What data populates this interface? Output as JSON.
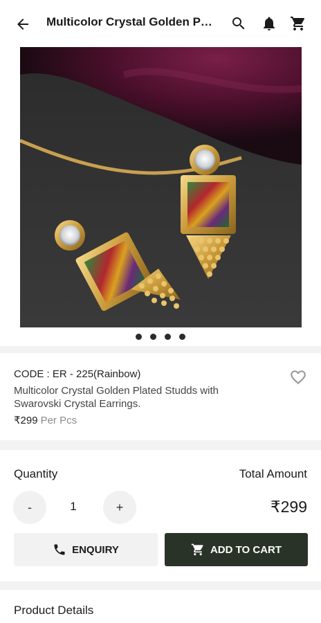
{
  "header": {
    "title": "Multicolor Crystal Golden Plated Studds with Swarovski Crystal Earrings",
    "back_icon": "arrow-back-icon",
    "search_icon": "search-icon",
    "notification_icon": "bell-icon",
    "cart_icon": "cart-icon"
  },
  "gallery": {
    "image_description": "product-photo-earrings",
    "dot_count": 4
  },
  "product": {
    "code": "CODE : ER - 225(Rainbow)",
    "description": "Multicolor Crystal Golden Plated Studds with Swarovski Crystal Earrings.",
    "price": "₹299",
    "unit": "Per Pcs",
    "wishlist_icon": "heart-outline-icon"
  },
  "purchase": {
    "quantity_label": "Quantity",
    "total_label": "Total Amount",
    "decrement_label": "-",
    "quantity_value": "1",
    "increment_label": "+",
    "total_value": "₹299",
    "enquiry_label": "ENQUIRY",
    "add_to_cart_label": "ADD TO CART"
  },
  "details": {
    "title": "Product Details"
  },
  "colors": {
    "cart_button_bg": "#2a3327",
    "enquiry_button_bg": "#f2f2f2"
  }
}
